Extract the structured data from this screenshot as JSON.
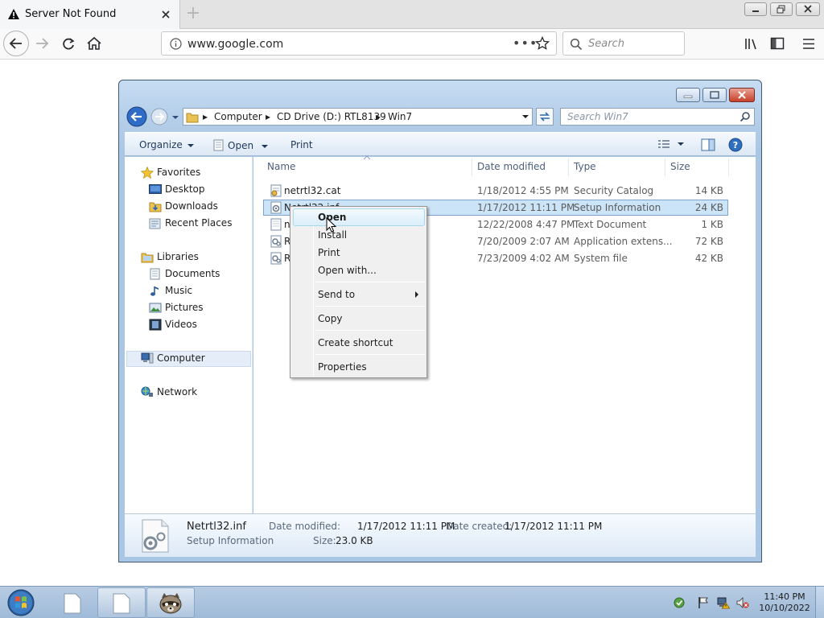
{
  "browser": {
    "tab_title": "Server Not Found",
    "url": "www.google.com",
    "search_placeholder": "Search"
  },
  "explorer": {
    "breadcrumb": [
      "Computer",
      "CD Drive (D:) RTL8139",
      "Win7"
    ],
    "search_placeholder": "Search Win7",
    "toolbar": {
      "organize": "Organize",
      "open": "Open",
      "print": "Print"
    },
    "nav": {
      "favorites": "Favorites",
      "desktop": "Desktop",
      "downloads": "Downloads",
      "recent": "Recent Places",
      "libraries": "Libraries",
      "documents": "Documents",
      "music": "Music",
      "pictures": "Pictures",
      "videos": "Videos",
      "computer": "Computer",
      "network": "Network"
    },
    "columns": {
      "name": "Name",
      "date": "Date modified",
      "type": "Type",
      "size": "Size"
    },
    "files": [
      {
        "name": "netrtl32.cat",
        "date": "1/18/2012 4:55 PM",
        "type": "Security Catalog",
        "size": "14 KB"
      },
      {
        "name": "Netrtl32.inf",
        "date": "1/17/2012 11:11 PM",
        "type": "Setup Information",
        "size": "24 KB"
      },
      {
        "name": "n",
        "date": "12/22/2008 4:47 PM",
        "type": "Text Document",
        "size": "1 KB"
      },
      {
        "name": "R",
        "date": "7/20/2009 2:07 AM",
        "type": "Application extens...",
        "size": "72 KB"
      },
      {
        "name": "R",
        "date": "7/23/2009 4:02 AM",
        "type": "System file",
        "size": "42 KB"
      }
    ],
    "details": {
      "name": "Netrtl32.inf",
      "kind": "Setup Information",
      "modified_label": "Date modified:",
      "modified": "1/17/2012 11:11 PM",
      "size_label": "Size:",
      "size": "23.0 KB",
      "created_label": "Date created:",
      "created": "1/17/2012 11:11 PM"
    }
  },
  "context_menu": {
    "open": "Open",
    "install": "Install",
    "print": "Print",
    "open_with": "Open with...",
    "send_to": "Send to",
    "copy": "Copy",
    "create_shortcut": "Create shortcut",
    "properties": "Properties"
  },
  "taskbar": {
    "time": "11:40 PM",
    "date": "10/10/2022"
  },
  "colors": {
    "selection": "#cce4f7",
    "window_frame": "#a9c6e4",
    "taskbar": "#9fbad8"
  }
}
